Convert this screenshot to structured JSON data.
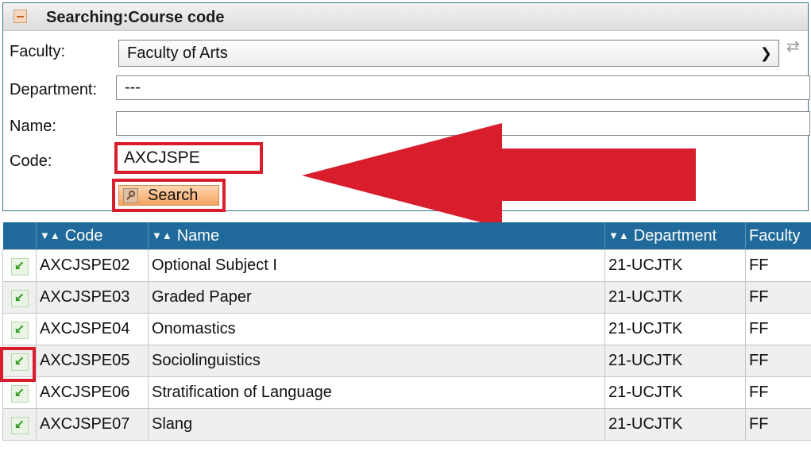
{
  "panel": {
    "title": "Searching:Course code",
    "faculty_label": "Faculty:",
    "faculty_value": "Faculty of Arts",
    "department_label": "Department:",
    "department_value": "---",
    "name_label": "Name:",
    "name_value": "",
    "code_label": "Code:",
    "code_value": "AXCJSPE",
    "search_label": "Search"
  },
  "annotation_color": "#d81e2c",
  "table": {
    "headers": [
      "Code",
      "Name",
      "Department",
      "Faculty"
    ],
    "rows": [
      {
        "code": "AXCJSPE02",
        "name": "Optional Subject I",
        "department": "21-UCJTK",
        "faculty": "FF"
      },
      {
        "code": "AXCJSPE03",
        "name": "Graded Paper",
        "department": "21-UCJTK",
        "faculty": "FF"
      },
      {
        "code": "AXCJSPE04",
        "name": "Onomastics",
        "department": "21-UCJTK",
        "faculty": "FF"
      },
      {
        "code": "AXCJSPE05",
        "name": "Sociolinguistics",
        "department": "21-UCJTK",
        "faculty": "FF"
      },
      {
        "code": "AXCJSPE06",
        "name": "Stratification of Language",
        "department": "21-UCJTK",
        "faculty": "FF"
      },
      {
        "code": "AXCJSPE07",
        "name": "Slang",
        "department": "21-UCJTK",
        "faculty": "FF"
      }
    ]
  }
}
